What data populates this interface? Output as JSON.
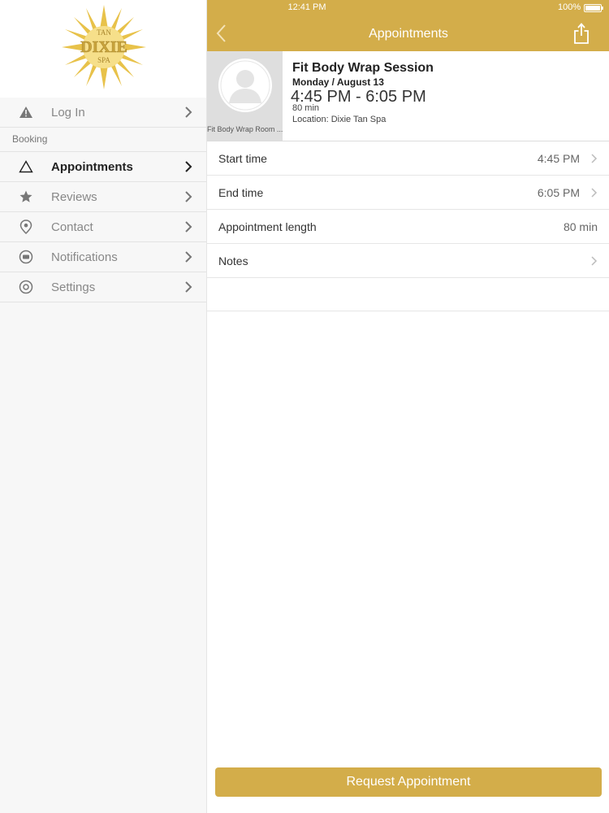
{
  "colors": {
    "accent": "#d3ad4a",
    "sidebar_bg": "#f7f7f7",
    "avatar_bg": "#dedede"
  },
  "status_bar": {
    "time": "12:41 PM",
    "battery": "100%"
  },
  "sidebar": {
    "logo": {
      "top": "TAN",
      "main": "DIXIE",
      "bottom": "SPA"
    },
    "login": {
      "label": "Log In",
      "icon": "warning-icon"
    },
    "section_label": "Booking",
    "items": [
      {
        "label": "Appointments",
        "icon": "triangle-outline-icon",
        "active": true
      },
      {
        "label": "Reviews",
        "icon": "star-icon"
      },
      {
        "label": "Contact",
        "icon": "location-pin-icon"
      },
      {
        "label": "Notifications",
        "icon": "chat-bubble-icon"
      },
      {
        "label": "Settings",
        "icon": "gear-icon"
      }
    ]
  },
  "navbar": {
    "title": "Appointments"
  },
  "summary": {
    "avatar_caption": "Fit Body Wrap Room ...",
    "title": "Fit Body Wrap Session",
    "date": "Monday / August 13",
    "time_range": "4:45 PM - 6:05 PM",
    "length": "80 min",
    "location": "Location: Dixie Tan Spa"
  },
  "details": [
    {
      "label": "Start time",
      "value": "4:45 PM"
    },
    {
      "label": "End time",
      "value": "6:05 PM"
    },
    {
      "label": "Appointment length",
      "value": "80 min"
    },
    {
      "label": "Notes",
      "value": ""
    }
  ],
  "request_button": "Request Appointment"
}
